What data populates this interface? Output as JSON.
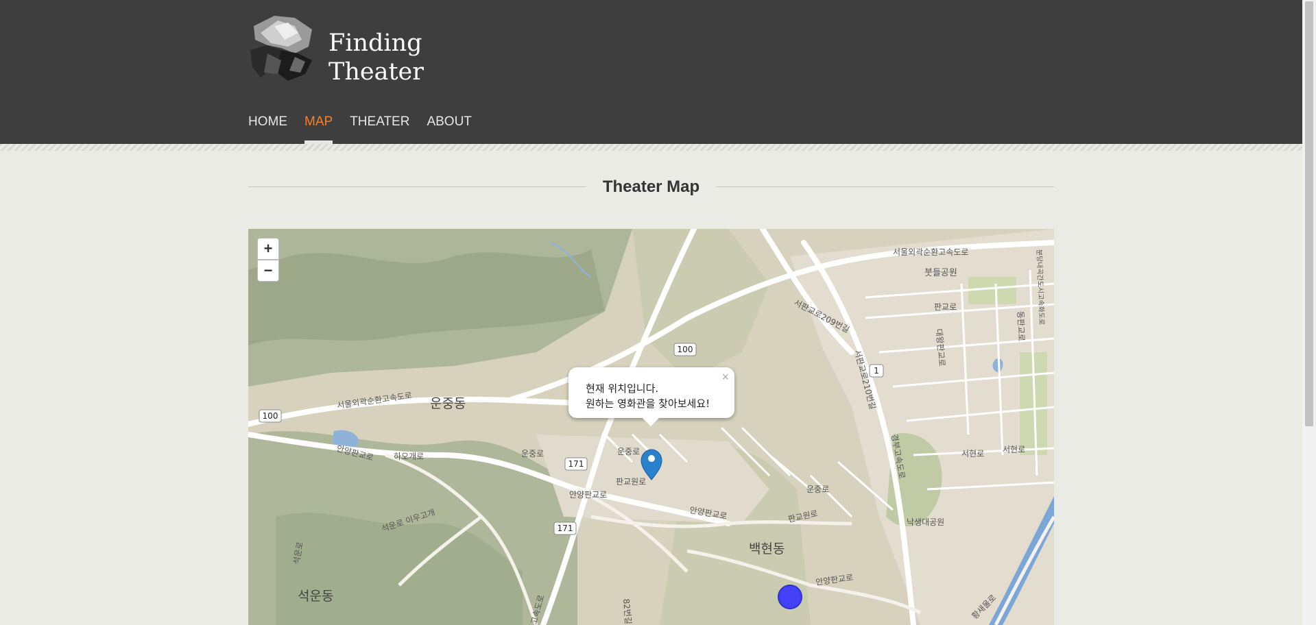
{
  "site": {
    "title_line1": "Finding",
    "title_line2": "Theater"
  },
  "nav": {
    "home": "HOME",
    "map": "MAP",
    "theater": "THEATER",
    "about": "ABOUT",
    "active": "MAP"
  },
  "page": {
    "heading": "Theater Map"
  },
  "map": {
    "zoom_in": "+",
    "zoom_out": "−",
    "popup": {
      "line1": "현재 위치입니다.",
      "line2": "원하는 영화관을 찾아보세요!",
      "close": "×"
    },
    "labels": {
      "ring_road": "서울외곽순환고속도로",
      "ring_road_2": "서울외곽순환고속도로",
      "park": "붓들공원",
      "pangyoro": "판교로",
      "pangyoro_209": "서판교로209번길",
      "pangyoro_210": "서판교로210번길",
      "route_100": "100",
      "route_100_b": "100",
      "route_1": "1",
      "route_171": "171",
      "route_171_b": "171",
      "unjungdong": "운중동",
      "anyangpangyoro": "안양판교로",
      "anyangpangyoro_2": "안양판교로",
      "anyangpangyoro_3": "안양판교로",
      "anyangpangyoro_4": "안양판교로",
      "haogaero": "하오개로",
      "unjungro": "운중로",
      "unjungro_2": "운중로",
      "unjungro_3": "운중로",
      "pangyowonro": "판교원로",
      "pangyowonro_2": "판교원로",
      "baekhyeondong": "백현동",
      "seogundong": "석운동",
      "seogunro": "석운로 이우고개",
      "seogunro_v": "석운로",
      "nakseongdae": "낙생대공원",
      "daewangpangyoro": "대왕판교로",
      "seohyeonro": "서현로",
      "seohyeonro_2": "서현로",
      "hwangsaeulro": "황새울로",
      "gyeongbu": "경부고속도로",
      "dongpangyoro": "동판교로",
      "gyeongbu_2": "분당내곡간도시고속화도로",
      "road_2": "고속도로",
      "road_82": "82번길"
    }
  }
}
